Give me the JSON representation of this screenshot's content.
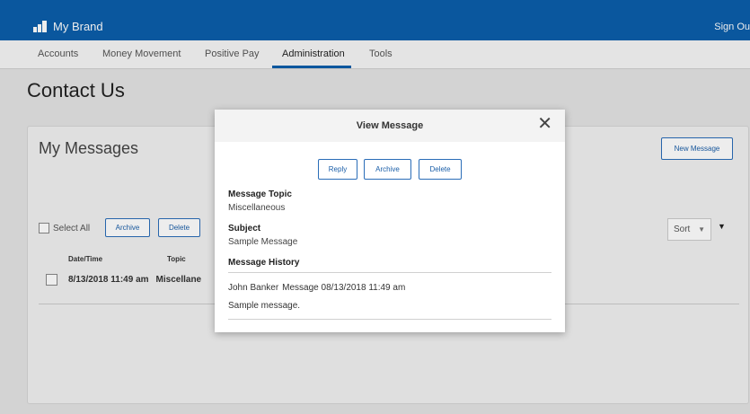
{
  "header": {
    "brand": "My Brand",
    "signout": "Sign Ou",
    "brand_color": "#0b5eab"
  },
  "nav": {
    "tabs": [
      {
        "label": "Accounts"
      },
      {
        "label": "Money Movement"
      },
      {
        "label": "Positive Pay"
      },
      {
        "label": "Administration",
        "active": true
      },
      {
        "label": "Tools"
      }
    ]
  },
  "page": {
    "title": "Contact Us"
  },
  "messages": {
    "title": "My Messages",
    "new_message": "New Message",
    "select_all": "Select All",
    "archive": "Archive",
    "delete": "Delete",
    "sort": "Sort",
    "columns": {
      "date": "Date/Time",
      "topic": "Topic"
    },
    "rows": [
      {
        "date": "8/13/2018 11:49 am",
        "topic": "Miscellane"
      }
    ]
  },
  "modal": {
    "title": "View Message",
    "reply": "Reply",
    "archive": "Archive",
    "delete": "Delete",
    "topic_label": "Message Topic",
    "topic_value": "Miscellaneous",
    "subject_label": "Subject",
    "subject_value": "Sample Message",
    "history_label": "Message History",
    "history": {
      "sender": "John Banker",
      "meta": "Message 08/13/2018 11:49 am",
      "body": "Sample message."
    }
  }
}
